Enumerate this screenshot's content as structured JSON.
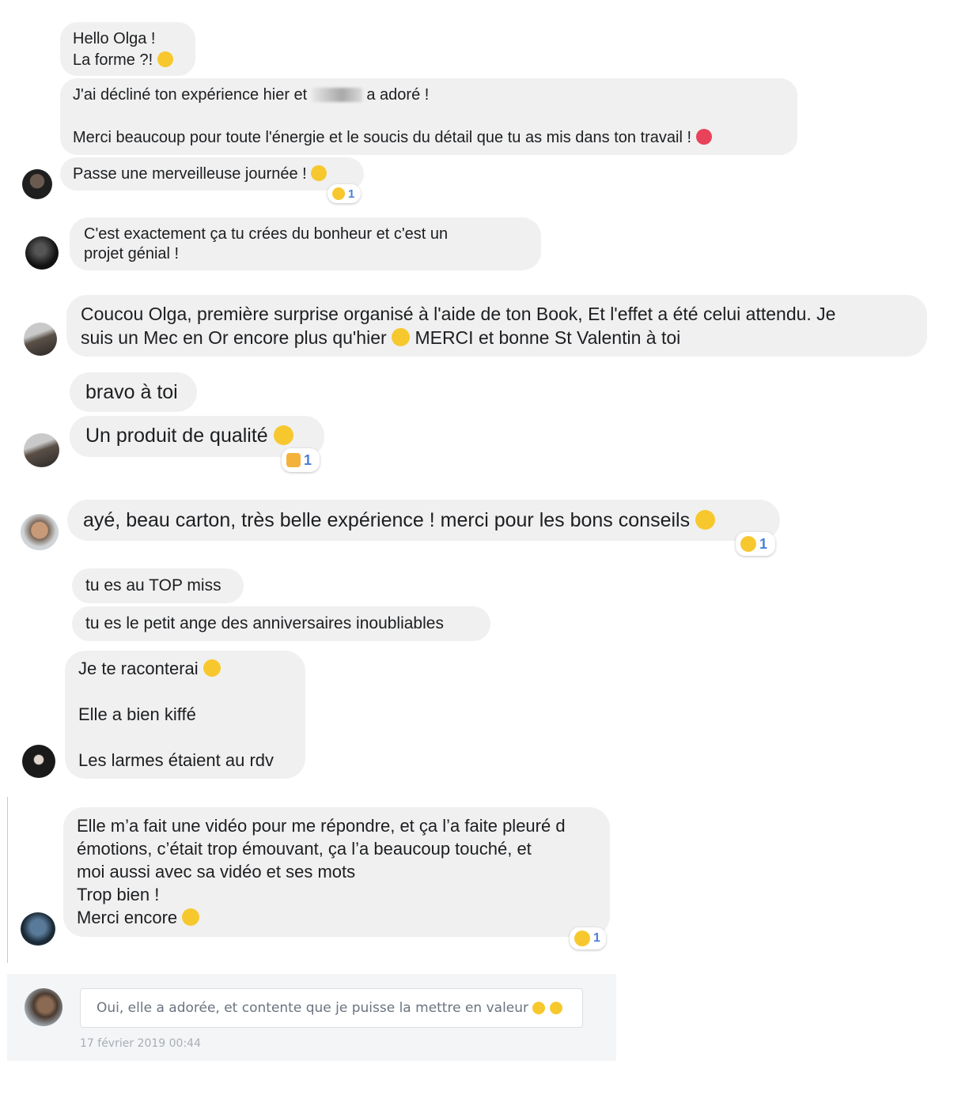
{
  "messages": [
    {
      "text_a": "Hello Olga !",
      "text_b": "La forme ?!",
      "emoji": "slight-smile"
    },
    {
      "line1_prefix": "J'ai décliné ton expérience hier et",
      "line1_suffix": "a adoré !",
      "line2": "Merci beaucoup pour toute l'énergie et le soucis du détail que tu as mis dans ton travail !",
      "emoji": "heart-pulse"
    },
    {
      "text": "Passe une merveilleuse journée !",
      "emoji": "relieved",
      "reaction": {
        "icon": "heart-eyes",
        "count": "1"
      }
    },
    {
      "text": "C'est exactement ça tu crées du bonheur et c'est un\nprojet génial !"
    },
    {
      "line1": "Coucou Olga, première surprise organisé à l'aide de ton Book, Et l'effet a été celui attendu. Je",
      "line2_prefix": "suis un Mec en Or encore plus qu'hier",
      "line2_suffix": "MERCI et bonne St Valentin à toi"
    },
    {
      "text": "bravo à toi"
    },
    {
      "text": "Un produit de qualité",
      "emoji": "wink",
      "reaction": {
        "icon": "thumbs-up",
        "count": "1"
      }
    },
    {
      "text": "ayé, beau carton, très belle expérience ! merci pour les bons conseils",
      "emoji": "slight-smile",
      "reaction": {
        "icon": "heart-eyes",
        "count": "1"
      }
    },
    {
      "text": "tu es au TOP miss"
    },
    {
      "text": "tu es le petit ange des anniversaires inoubliables"
    },
    {
      "line1": "Je te raconterai",
      "line2": "Elle a bien kiffé",
      "line3": "Les larmes étaient au rdv"
    },
    {
      "text": "Elle m’a fait une vidéo pour me répondre, et ça l’a faite pleuré d\némotions, c’était trop émouvant, ça l’a beaucoup touché, et\nmoi aussi avec sa vidéo et ses mots\nTrop bien !",
      "last_line": "Merci encore",
      "emoji": "hugging",
      "reaction": {
        "icon": "heart-eyes",
        "count": "1"
      }
    }
  ],
  "composer": {
    "input_value": "Oui, elle a adorée, et contente que je puisse la mettre en valeur",
    "input_emoji": "heart-eyes",
    "timestamp": "17 février 2019 00:44"
  },
  "colors": {
    "bubble": "#f0f0f0",
    "reaction_count": "#4a7fd9",
    "emoji_yellow": "#f7c82e"
  }
}
